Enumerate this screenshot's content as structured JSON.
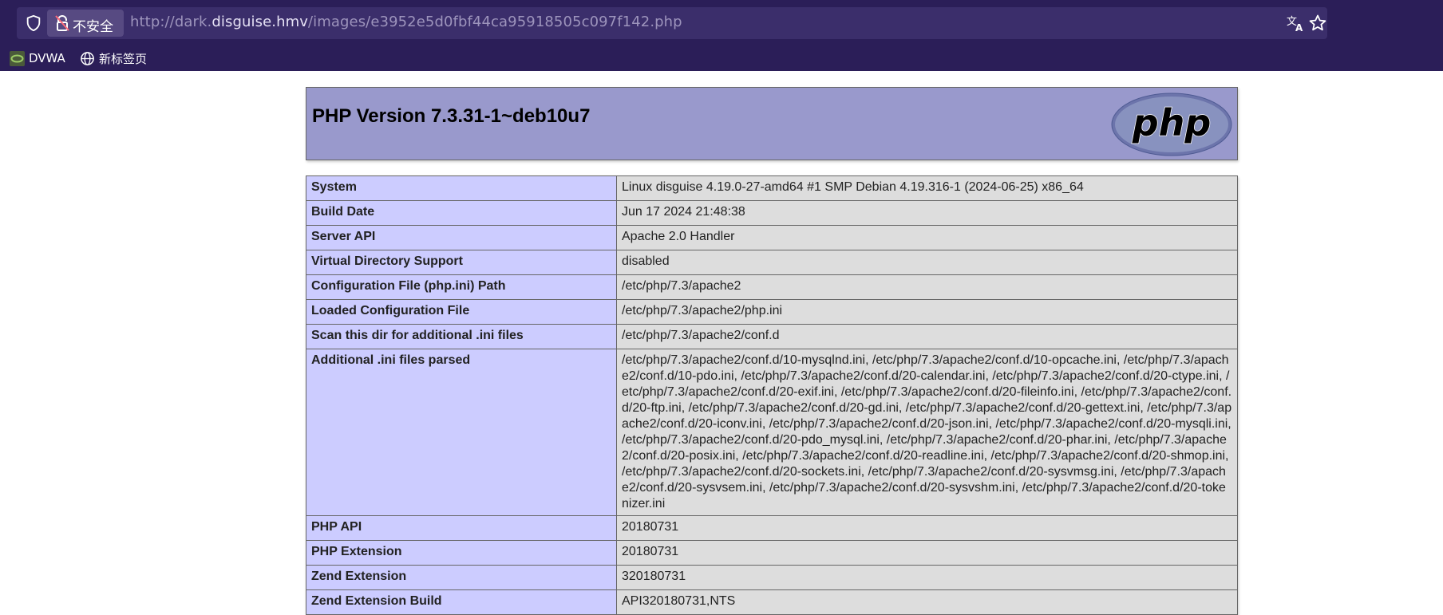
{
  "browser": {
    "security_label": "不安全",
    "url_prefix": "http://dark.",
    "url_host": "disguise.hmv",
    "url_path": "/images/e3952e5d0fbf44ca95918505c097f142.php",
    "bookmarks": [
      {
        "label": "DVWA",
        "icon": "dvwa-favicon"
      },
      {
        "label": "新标签页",
        "icon": "globe-icon"
      }
    ]
  },
  "php": {
    "title": "PHP Version 7.3.31-1~deb10u7",
    "logo_text": "php",
    "rows": [
      {
        "key": "System",
        "value": "Linux disguise 4.19.0-27-amd64 #1 SMP Debian 4.19.316-1 (2024-06-25) x86_64"
      },
      {
        "key": "Build Date",
        "value": "Jun 17 2024 21:48:38"
      },
      {
        "key": "Server API",
        "value": "Apache 2.0 Handler"
      },
      {
        "key": "Virtual Directory Support",
        "value": "disabled"
      },
      {
        "key": "Configuration File (php.ini) Path",
        "value": "/etc/php/7.3/apache2"
      },
      {
        "key": "Loaded Configuration File",
        "value": "/etc/php/7.3/apache2/php.ini"
      },
      {
        "key": "Scan this dir for additional .ini files",
        "value": "/etc/php/7.3/apache2/conf.d"
      },
      {
        "key": "Additional .ini files parsed",
        "value": "/etc/php/7.3/apache2/conf.d/10-mysqlnd.ini, /etc/php/7.3/apache2/conf.d/10-opcache.ini, /etc/php/7.3/apache2/conf.d/10-pdo.ini, /etc/php/7.3/apache2/conf.d/20-calendar.ini, /etc/php/7.3/apache2/conf.d/20-ctype.ini, /etc/php/7.3/apache2/conf.d/20-exif.ini, /etc/php/7.3/apache2/conf.d/20-fileinfo.ini, /etc/php/7.3/apache2/conf.d/20-ftp.ini, /etc/php/7.3/apache2/conf.d/20-gd.ini, /etc/php/7.3/apache2/conf.d/20-gettext.ini, /etc/php/7.3/apache2/conf.d/20-iconv.ini, /etc/php/7.3/apache2/conf.d/20-json.ini, /etc/php/7.3/apache2/conf.d/20-mysqli.ini, /etc/php/7.3/apache2/conf.d/20-pdo_mysql.ini, /etc/php/7.3/apache2/conf.d/20-phar.ini, /etc/php/7.3/apache2/conf.d/20-posix.ini, /etc/php/7.3/apache2/conf.d/20-readline.ini, /etc/php/7.3/apache2/conf.d/20-shmop.ini, /etc/php/7.3/apache2/conf.d/20-sockets.ini, /etc/php/7.3/apache2/conf.d/20-sysvmsg.ini, /etc/php/7.3/apache2/conf.d/20-sysvsem.ini, /etc/php/7.3/apache2/conf.d/20-sysvshm.ini, /etc/php/7.3/apache2/conf.d/20-tokenizer.ini"
      },
      {
        "key": "PHP API",
        "value": "20180731"
      },
      {
        "key": "PHP Extension",
        "value": "20180731"
      },
      {
        "key": "Zend Extension",
        "value": "320180731"
      },
      {
        "key": "Zend Extension Build",
        "value": "API320180731,NTS"
      }
    ]
  }
}
